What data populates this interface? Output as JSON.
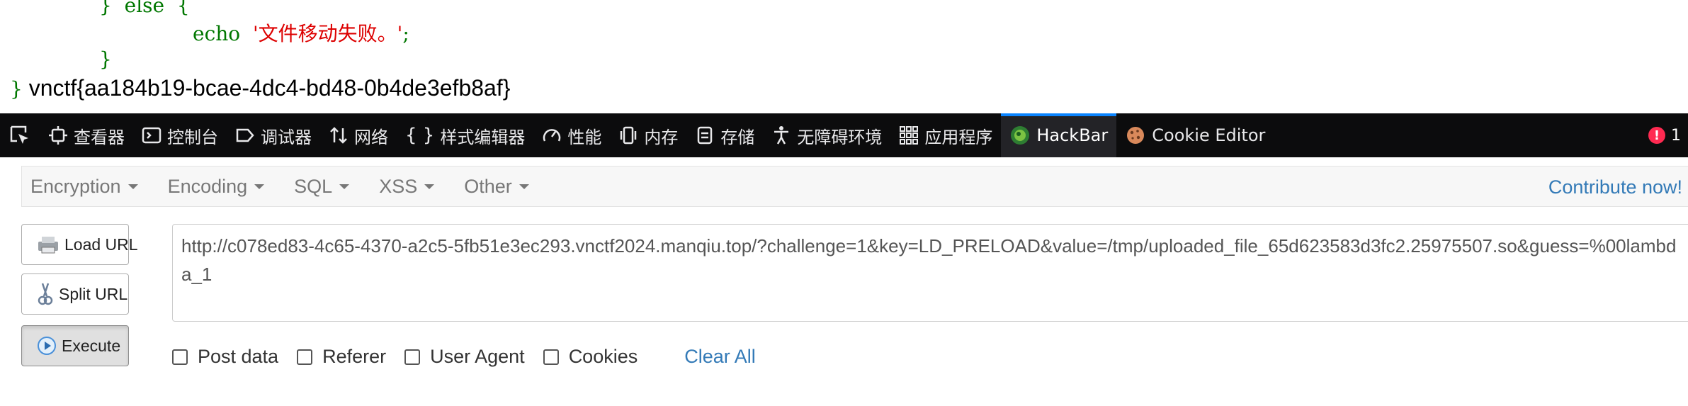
{
  "code": {
    "line1_brace": "}",
    "line1_else": "else",
    "line1_open": "{",
    "line2_echo": "echo",
    "line2_string": "'文件移动失败。'",
    "line2_semicolon": ";",
    "line3_brace": "}",
    "line4_brace": "}",
    "flag": "vnctf{aa184b19-bcae-4dc4-bd48-0b4de3efb8af}"
  },
  "devtools": {
    "tabs": [
      {
        "label": "查看器",
        "icon": "inspector-icon"
      },
      {
        "label": "控制台",
        "icon": "console-icon"
      },
      {
        "label": "调试器",
        "icon": "debugger-icon"
      },
      {
        "label": "网络",
        "icon": "network-icon"
      },
      {
        "label": "样式编辑器",
        "icon": "style-editor-icon"
      },
      {
        "label": "性能",
        "icon": "performance-icon"
      },
      {
        "label": "内存",
        "icon": "memory-icon"
      },
      {
        "label": "存储",
        "icon": "storage-icon"
      },
      {
        "label": "无障碍环境",
        "icon": "accessibility-icon"
      },
      {
        "label": "应用程序",
        "icon": "application-icon"
      },
      {
        "label": "HackBar",
        "icon": "hackbar-icon"
      },
      {
        "label": "Cookie Editor",
        "icon": "cookie-icon"
      }
    ],
    "active_tab": "HackBar",
    "error_count": "1"
  },
  "hackbar": {
    "menus": [
      "Encryption",
      "Encoding",
      "SQL",
      "XSS",
      "Other"
    ],
    "contribute": "Contribute now!",
    "buttons": {
      "load_url": "Load URL",
      "split_url": "Split URL",
      "execute": "Execute"
    },
    "url": "http://c078ed83-4c65-4370-a2c5-5fb51e3ec293.vnctf2024.manqiu.top/?challenge=1&key=LD_PRELOAD&value=/tmp/uploaded_file_65d623583d3fc2.25975507.so&guess=%00lambda_1",
    "options": [
      "Post data",
      "Referer",
      "User Agent",
      "Cookies"
    ],
    "clear_all": "Clear All"
  },
  "colors": {
    "php_keyword": "#007700",
    "php_string": "#dd0000",
    "devtools_bg": "#0c0c0d",
    "active_tab_accent": "#0a84ff",
    "link": "#337ab7",
    "error_badge": "#ff2a51"
  }
}
